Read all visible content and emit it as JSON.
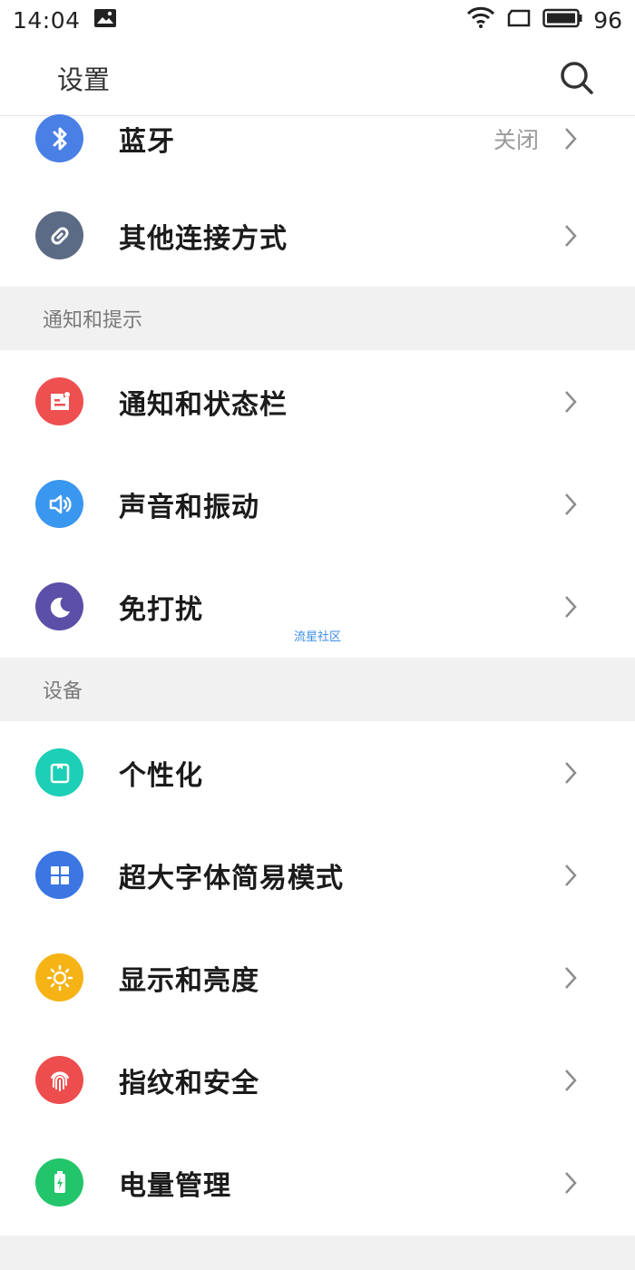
{
  "status_bar": {
    "time": "14:04",
    "battery": "96"
  },
  "header": {
    "title": "设置"
  },
  "rows_top": [
    {
      "label": "蓝牙",
      "value": "关闭",
      "icon": "bluetooth-icon",
      "color": "#4a7fe6"
    },
    {
      "label": "其他连接方式",
      "value": "",
      "icon": "link-icon",
      "color": "#5c6b85"
    }
  ],
  "section_notify": {
    "title": "通知和提示"
  },
  "rows_notify": [
    {
      "label": "通知和状态栏",
      "icon": "notification-icon",
      "color": "#ee4f4f"
    },
    {
      "label": "声音和振动",
      "icon": "speaker-icon",
      "color": "#3a97ef"
    },
    {
      "label": "免打扰",
      "icon": "moon-icon",
      "color": "#5b4fa8"
    }
  ],
  "section_device": {
    "title": "设备"
  },
  "rows_device": [
    {
      "label": "个性化",
      "icon": "personalize-icon",
      "color": "#1ccfb6"
    },
    {
      "label": "超大字体简易模式",
      "icon": "grid-icon",
      "color": "#3b76e3"
    },
    {
      "label": "显示和亮度",
      "icon": "sun-icon",
      "color": "#f5b316"
    },
    {
      "label": "指纹和安全",
      "icon": "fingerprint-icon",
      "color": "#ed4d4d"
    },
    {
      "label": "电量管理",
      "icon": "battery-charge-icon",
      "color": "#23c56b"
    }
  ],
  "watermark": "流星社区"
}
